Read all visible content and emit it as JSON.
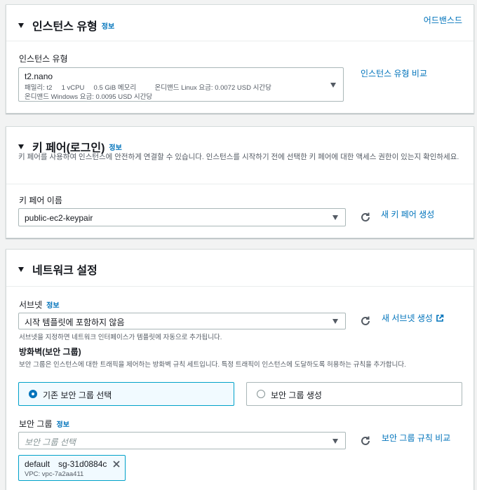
{
  "instance_type": {
    "title": "인스턴스 유형",
    "info": "정보",
    "advisor_link": "어드밴스드",
    "field_label": "인스턴스 유형",
    "selected": "t2.nano",
    "detail_line1": "패밀리: t2     1 vCPU     0.5 GiB 메모리          온디맨드 Linux 요금: 0.0072 USD 시간당",
    "detail_line2": "온디맨드 Windows 요금: 0.0095 USD 시간당",
    "compare_link": "인스턴스 유형 비교"
  },
  "key_pair": {
    "title": "키 페어(로그인)",
    "info": "정보",
    "description": "키 페어를 사용하여 인스턴스에 안전하게 연결할 수 있습니다. 인스턴스를 시작하기 전에 선택한 키 페어에 대한 액세스 권한이 있는지 확인하세요.",
    "field_label": "키 페어 이름",
    "selected": "public-ec2-keypair",
    "create_link": "새 키 페어 생성"
  },
  "network": {
    "title": "네트워크 설정",
    "subnet_label": "서브넷",
    "subnet_info": "정보",
    "subnet_selected": "시작 템플릿에 포함하지 않음",
    "subnet_hint": "서브넷을 지정하면 네트워크 인터페이스가 템플릿에 자동으로 추가됩니다.",
    "new_subnet_link": "새 서브넷 생성",
    "firewall_label": "방화벽(보안 그룹)",
    "firewall_desc": "보안 그룹은 인스턴스에 대한 트래픽을 제어하는 방화벽 규칙 세트입니다. 특정 트래픽이 인스턴스에 도달하도록 허용하는 규칙을 추가합니다.",
    "radio_existing": "기존 보안 그룹 선택",
    "radio_create": "보안 그룹 생성",
    "sg_label": "보안 그룹",
    "sg_info": "정보",
    "sg_placeholder": "보안 그룹 선택",
    "sg_compare_link": "보안 그룹 규칙 비교",
    "token_name": "default",
    "token_id": "sg-31d0884c",
    "token_vpc": "VPC: vpc-7a2aa411"
  },
  "colors": {
    "link": "#0073bb",
    "selected_border": "#00a1c9"
  }
}
